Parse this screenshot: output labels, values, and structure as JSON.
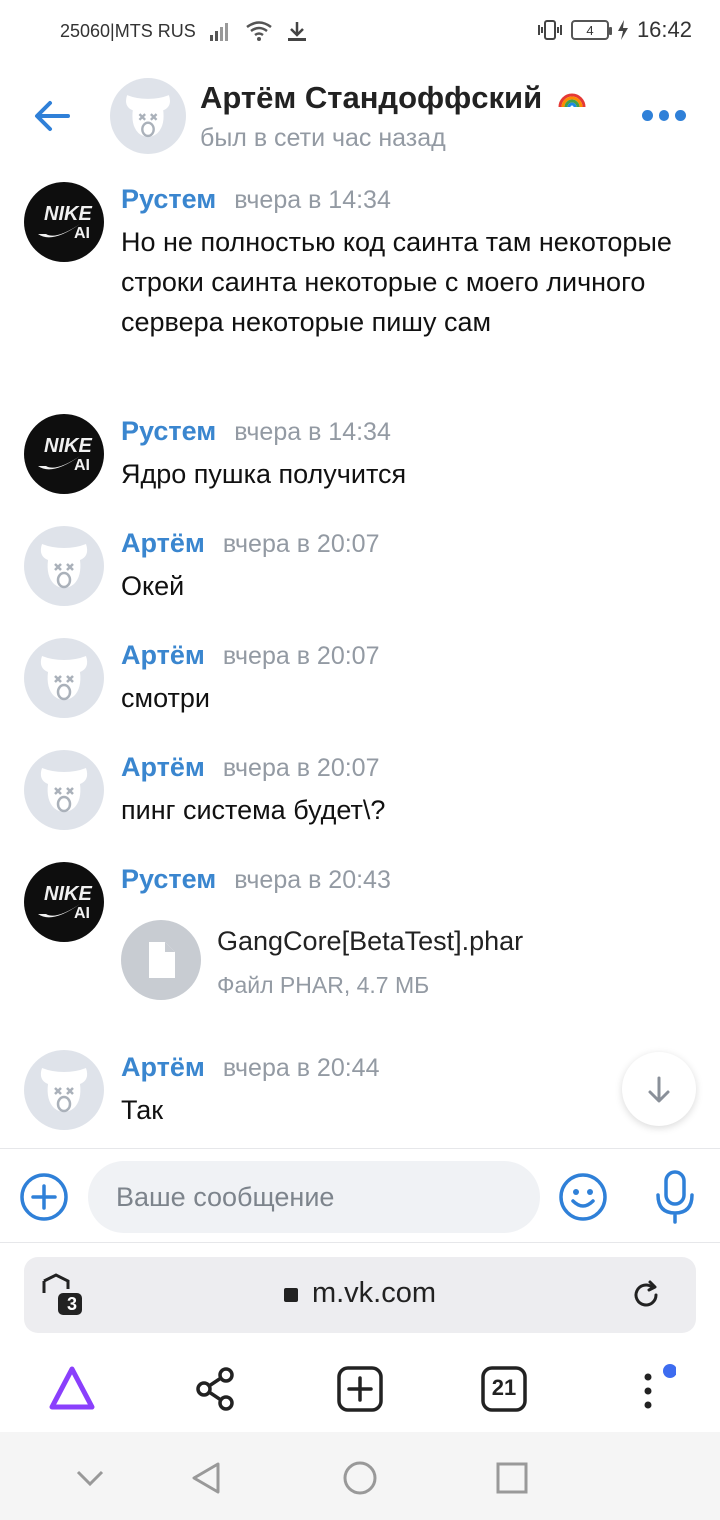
{
  "status_bar": {
    "carrier": "25060|MTS RUS",
    "battery": "4",
    "time": "16:42"
  },
  "header": {
    "name": "Артём Стандоффский",
    "status": "был в сети час назад",
    "icons": [
      "back-arrow-icon",
      "avatar-dog-icon",
      "rainbow-icon",
      "more-dots-icon"
    ]
  },
  "messages": [
    {
      "author": "Рустем",
      "time": "вчера в 14:34",
      "text": "Но не полностью код саинта там некоторые строки саинта некоторые с моего личного сервера некоторые пишу сам"
    },
    {
      "author": "Рустем",
      "time": "вчера в 14:34",
      "text": "Ядро пушка получится"
    },
    {
      "author": "Артём",
      "time": "вчера в 20:07",
      "text": "Окей"
    },
    {
      "author": "Артём",
      "time": "вчера в 20:07",
      "text": "смотри"
    },
    {
      "author": "Артём",
      "time": "вчера в 20:07",
      "text": "пинг система будет\\?"
    },
    {
      "author": "Рустем",
      "time": "вчера в 20:43",
      "file_name": "GangCore[BetaTest].phar",
      "file_meta": "Файл PHAR, 4.7 МБ"
    },
    {
      "author": "Артём",
      "time": "вчера в 20:44",
      "text": "Так"
    }
  ],
  "composer": {
    "placeholder": "Ваше сообщение"
  },
  "browser": {
    "url": "m.vk.com",
    "protect_count": "3",
    "tabs_count": "21",
    "accent": "#3a86cf"
  }
}
